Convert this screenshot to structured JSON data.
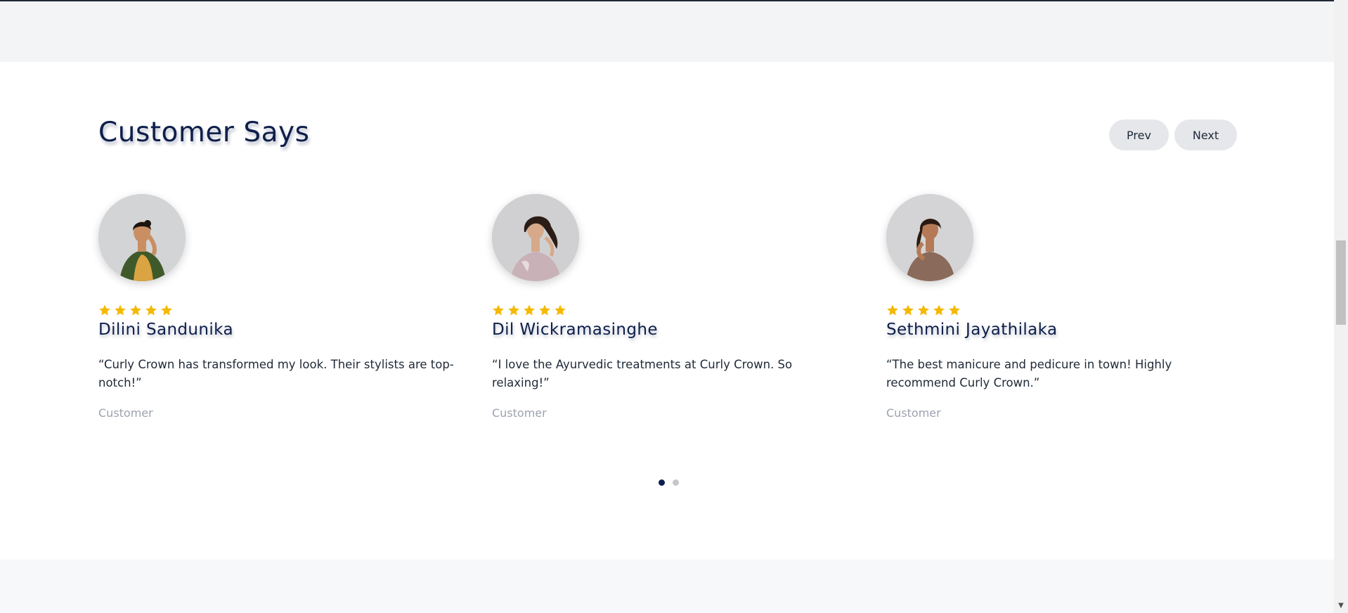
{
  "section": {
    "title": "Customer Says",
    "prev_label": "Prev",
    "next_label": "Next"
  },
  "testimonials": [
    {
      "name": "Dilini Sandunika",
      "rating": 5,
      "quote": "“Curly Crown has transformed my look. Their stylists are top-notch!”",
      "role": "Customer"
    },
    {
      "name": "Dil Wickramasinghe",
      "rating": 5,
      "quote": "“I love the Ayurvedic treatments at Curly Crown. So relaxing!”",
      "role": "Customer"
    },
    {
      "name": "Sethmini Jayathilaka",
      "rating": 5,
      "quote": "“The best manicure and pedicure in town! Highly recommend Curly Crown.”",
      "role": "Customer"
    }
  ],
  "pagination": {
    "pages": 2,
    "active": 1
  },
  "next_section": {
    "partial_heading": ""
  },
  "colors": {
    "heading": "#0f1f4b",
    "star": "#f5b800",
    "button_bg": "#e5e7eb",
    "dot_active": "#0f1f4b",
    "dot_inactive": "#c4c6ca"
  }
}
